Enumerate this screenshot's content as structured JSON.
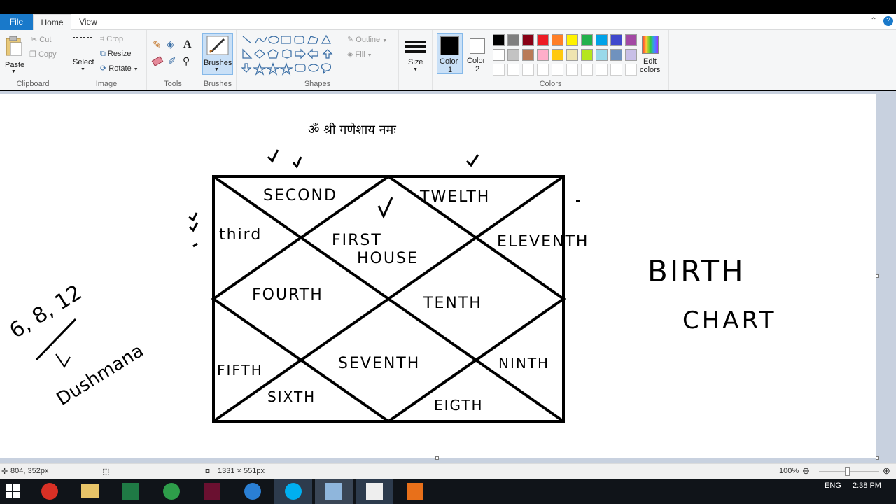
{
  "menu": {
    "file": "File",
    "home": "Home",
    "view": "View"
  },
  "ribbon": {
    "clipboard": {
      "paste": "Paste",
      "cut": "Cut",
      "copy": "Copy",
      "label": "Clipboard"
    },
    "image": {
      "select": "Select",
      "crop": "Crop",
      "resize": "Resize",
      "rotate": "Rotate",
      "label": "Image"
    },
    "tools": {
      "label": "Tools"
    },
    "brushes": {
      "label": "Brushes"
    },
    "shapes": {
      "outline": "Outline",
      "fill": "Fill",
      "label": "Shapes"
    },
    "size": {
      "label": "Size"
    },
    "colors": {
      "color1": "Color",
      "color1_num": "1",
      "color2": "Color",
      "color2_num": "2",
      "edit": "Edit",
      "edit2": "colors",
      "label": "Colors",
      "palette_row1": [
        "#000000",
        "#7f7f7f",
        "#880015",
        "#ed1c24",
        "#ff7f27",
        "#fff200",
        "#22b14c",
        "#00a2e8",
        "#3f48cc",
        "#a349a4"
      ],
      "palette_row2": [
        "#ffffff",
        "#c3c3c3",
        "#b97a57",
        "#ffaec9",
        "#ffc90e",
        "#efe4b0",
        "#b5e61d",
        "#99d9ea",
        "#7092be",
        "#c8bfe7"
      ],
      "color1_value": "#000000",
      "color2_value": "#ffffff"
    }
  },
  "drawing": {
    "invocation": "ॐ श्री गणेशाय नमः",
    "houses": {
      "first_a": "FIRST",
      "first_b": "HOUSE",
      "second": "SECOND",
      "third": "third",
      "fourth": "FOURTH",
      "fifth": "FIFTH",
      "sixth": "SIXTH",
      "seventh": "SEVENTH",
      "eighth": "EIGTH",
      "ninth": "NINTH",
      "tenth": "TENTH",
      "eleventh": "ELEVENTH",
      "twelfth": "TWELTH"
    },
    "side_note_numbers": "6, 8, 12",
    "side_note_word": "Dushmana",
    "title_a": "BIRTH",
    "title_b": "CHART"
  },
  "status": {
    "cursor_pos": "804, 352px",
    "image_size": "1331 × 551px",
    "zoom": "100%"
  },
  "taskbar": {
    "lang": "ENG",
    "time": "2:38 PM"
  }
}
